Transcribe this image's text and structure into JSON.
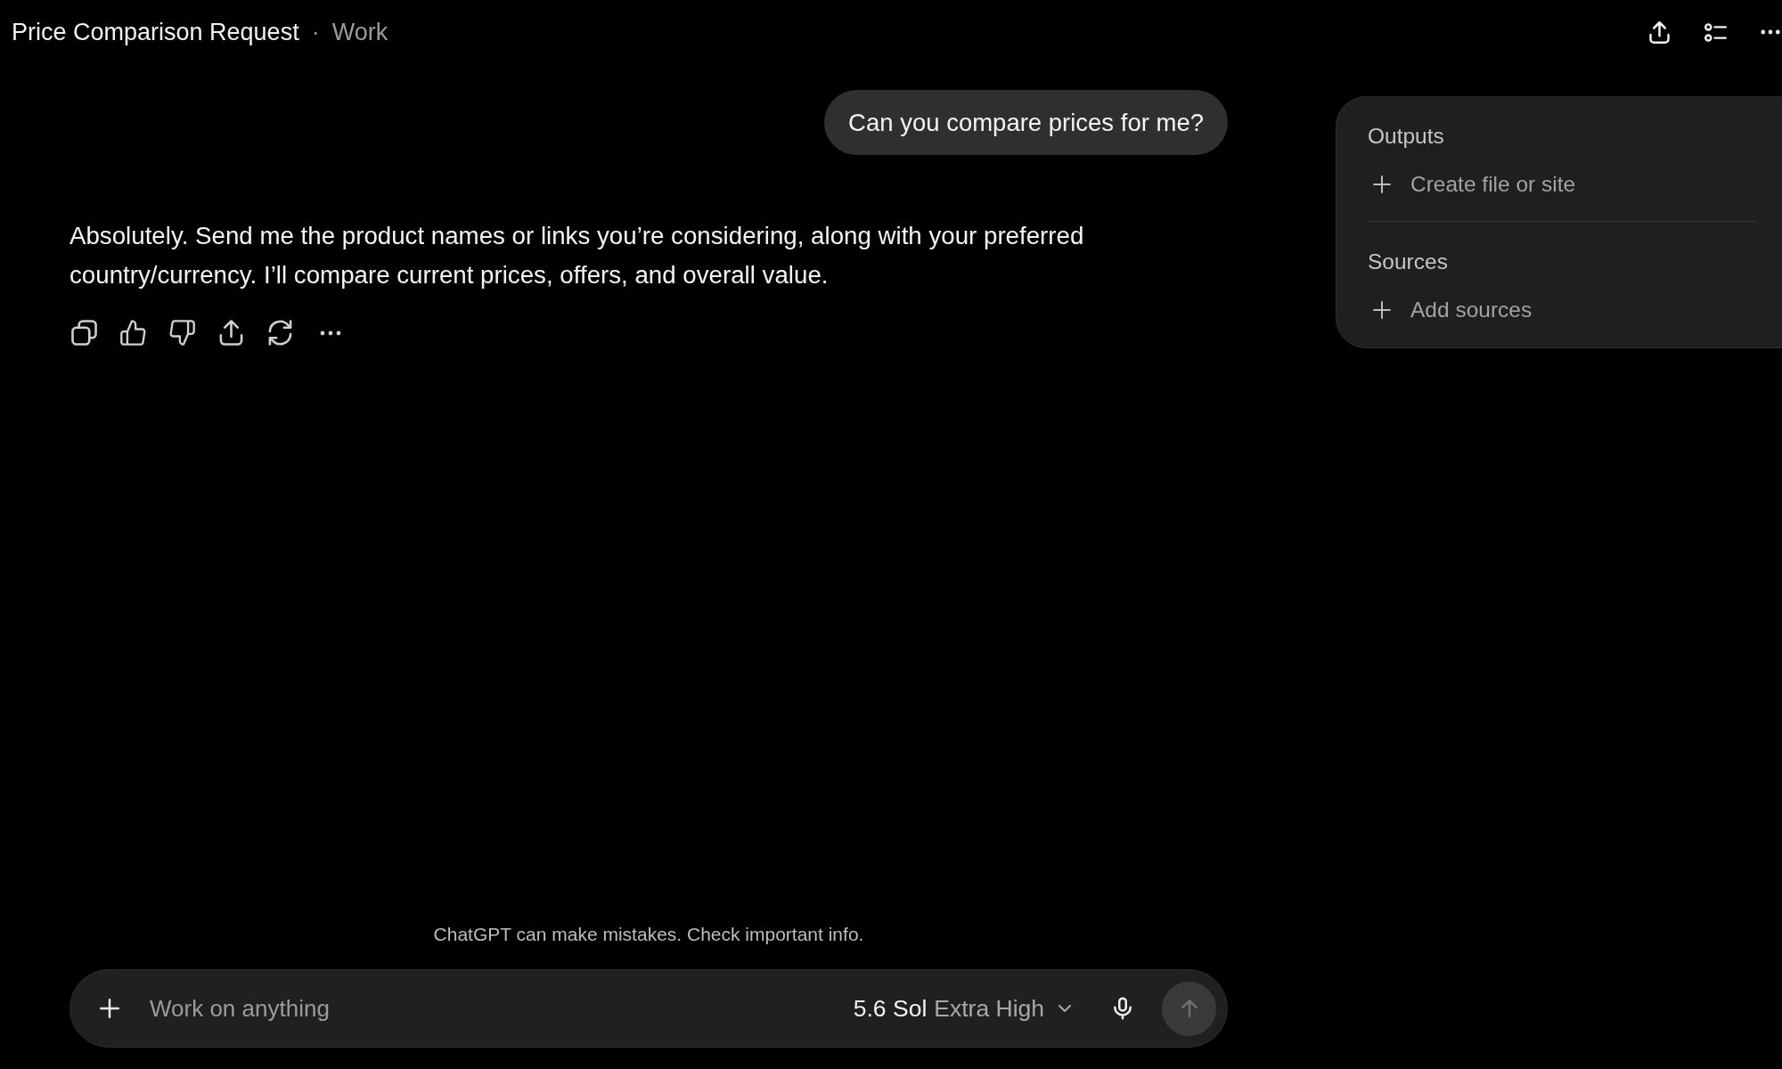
{
  "header": {
    "title": "Price Comparison Request",
    "separator": "·",
    "project": "Work"
  },
  "messages": [
    {
      "kind": "prompt",
      "text": "Can you compare prices for me?"
    },
    {
      "kind": "reply",
      "text": "Absolutely. Send me the product names or links you’re considering, along with your preferred country/currency. I’ll compare current prices, offers, and overall value."
    }
  ],
  "disclaimer": "ChatGPT can make mistakes. Check important info.",
  "composer": {
    "placeholder": "Work on anything",
    "model": "5.6 Sol",
    "effort": "Extra High",
    "send_button": {
      "disabled": true
    }
  },
  "panel": {
    "sections": [
      {
        "title": "Outputs",
        "items": [
          {
            "label": "Create file or site"
          }
        ]
      },
      {
        "title": "Sources",
        "items": [
          {
            "label": "Add sources"
          }
        ]
      }
    ]
  }
}
